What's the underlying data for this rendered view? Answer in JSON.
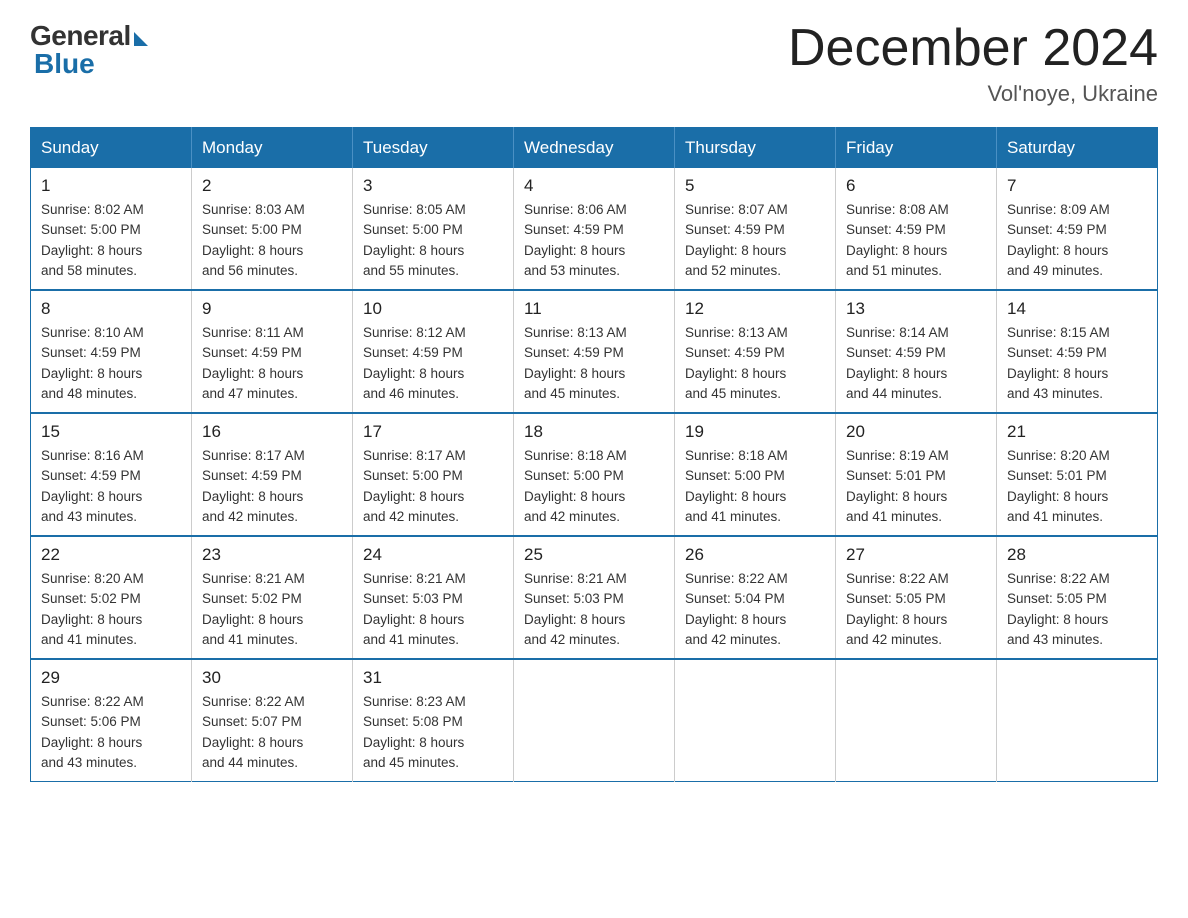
{
  "header": {
    "logo_general": "General",
    "logo_blue": "Blue",
    "month_title": "December 2024",
    "location": "Vol'noye, Ukraine"
  },
  "weekdays": [
    "Sunday",
    "Monday",
    "Tuesday",
    "Wednesday",
    "Thursday",
    "Friday",
    "Saturday"
  ],
  "weeks": [
    [
      {
        "day": "1",
        "sunrise": "8:02 AM",
        "sunset": "5:00 PM",
        "daylight": "8 hours and 58 minutes."
      },
      {
        "day": "2",
        "sunrise": "8:03 AM",
        "sunset": "5:00 PM",
        "daylight": "8 hours and 56 minutes."
      },
      {
        "day": "3",
        "sunrise": "8:05 AM",
        "sunset": "5:00 PM",
        "daylight": "8 hours and 55 minutes."
      },
      {
        "day": "4",
        "sunrise": "8:06 AM",
        "sunset": "4:59 PM",
        "daylight": "8 hours and 53 minutes."
      },
      {
        "day": "5",
        "sunrise": "8:07 AM",
        "sunset": "4:59 PM",
        "daylight": "8 hours and 52 minutes."
      },
      {
        "day": "6",
        "sunrise": "8:08 AM",
        "sunset": "4:59 PM",
        "daylight": "8 hours and 51 minutes."
      },
      {
        "day": "7",
        "sunrise": "8:09 AM",
        "sunset": "4:59 PM",
        "daylight": "8 hours and 49 minutes."
      }
    ],
    [
      {
        "day": "8",
        "sunrise": "8:10 AM",
        "sunset": "4:59 PM",
        "daylight": "8 hours and 48 minutes."
      },
      {
        "day": "9",
        "sunrise": "8:11 AM",
        "sunset": "4:59 PM",
        "daylight": "8 hours and 47 minutes."
      },
      {
        "day": "10",
        "sunrise": "8:12 AM",
        "sunset": "4:59 PM",
        "daylight": "8 hours and 46 minutes."
      },
      {
        "day": "11",
        "sunrise": "8:13 AM",
        "sunset": "4:59 PM",
        "daylight": "8 hours and 45 minutes."
      },
      {
        "day": "12",
        "sunrise": "8:13 AM",
        "sunset": "4:59 PM",
        "daylight": "8 hours and 45 minutes."
      },
      {
        "day": "13",
        "sunrise": "8:14 AM",
        "sunset": "4:59 PM",
        "daylight": "8 hours and 44 minutes."
      },
      {
        "day": "14",
        "sunrise": "8:15 AM",
        "sunset": "4:59 PM",
        "daylight": "8 hours and 43 minutes."
      }
    ],
    [
      {
        "day": "15",
        "sunrise": "8:16 AM",
        "sunset": "4:59 PM",
        "daylight": "8 hours and 43 minutes."
      },
      {
        "day": "16",
        "sunrise": "8:17 AM",
        "sunset": "4:59 PM",
        "daylight": "8 hours and 42 minutes."
      },
      {
        "day": "17",
        "sunrise": "8:17 AM",
        "sunset": "5:00 PM",
        "daylight": "8 hours and 42 minutes."
      },
      {
        "day": "18",
        "sunrise": "8:18 AM",
        "sunset": "5:00 PM",
        "daylight": "8 hours and 42 minutes."
      },
      {
        "day": "19",
        "sunrise": "8:18 AM",
        "sunset": "5:00 PM",
        "daylight": "8 hours and 41 minutes."
      },
      {
        "day": "20",
        "sunrise": "8:19 AM",
        "sunset": "5:01 PM",
        "daylight": "8 hours and 41 minutes."
      },
      {
        "day": "21",
        "sunrise": "8:20 AM",
        "sunset": "5:01 PM",
        "daylight": "8 hours and 41 minutes."
      }
    ],
    [
      {
        "day": "22",
        "sunrise": "8:20 AM",
        "sunset": "5:02 PM",
        "daylight": "8 hours and 41 minutes."
      },
      {
        "day": "23",
        "sunrise": "8:21 AM",
        "sunset": "5:02 PM",
        "daylight": "8 hours and 41 minutes."
      },
      {
        "day": "24",
        "sunrise": "8:21 AM",
        "sunset": "5:03 PM",
        "daylight": "8 hours and 41 minutes."
      },
      {
        "day": "25",
        "sunrise": "8:21 AM",
        "sunset": "5:03 PM",
        "daylight": "8 hours and 42 minutes."
      },
      {
        "day": "26",
        "sunrise": "8:22 AM",
        "sunset": "5:04 PM",
        "daylight": "8 hours and 42 minutes."
      },
      {
        "day": "27",
        "sunrise": "8:22 AM",
        "sunset": "5:05 PM",
        "daylight": "8 hours and 42 minutes."
      },
      {
        "day": "28",
        "sunrise": "8:22 AM",
        "sunset": "5:05 PM",
        "daylight": "8 hours and 43 minutes."
      }
    ],
    [
      {
        "day": "29",
        "sunrise": "8:22 AM",
        "sunset": "5:06 PM",
        "daylight": "8 hours and 43 minutes."
      },
      {
        "day": "30",
        "sunrise": "8:22 AM",
        "sunset": "5:07 PM",
        "daylight": "8 hours and 44 minutes."
      },
      {
        "day": "31",
        "sunrise": "8:23 AM",
        "sunset": "5:08 PM",
        "daylight": "8 hours and 45 minutes."
      },
      null,
      null,
      null,
      null
    ]
  ]
}
